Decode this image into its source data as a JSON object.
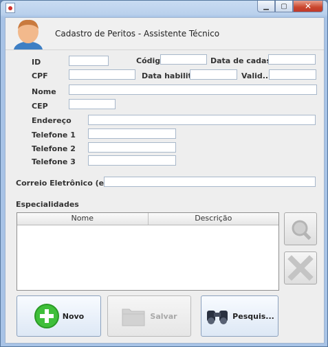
{
  "header": {
    "title": "Cadastro de Peritos - Assistente Técnico"
  },
  "form": {
    "id_label": "ID",
    "codigo_label": "Código",
    "data_cadastro_label": "Data de cadastro",
    "cpf_label": "CPF",
    "data_habilitacao_label": "Data habilitação",
    "validade_label": "Valid...",
    "nome_label": "Nome",
    "cep_label": "CEP",
    "endereco_label": "Endereço",
    "telefone1_label": "Telefone 1",
    "telefone2_label": "Telefone 2",
    "telefone3_label": "Telefone 3",
    "email_label": "Correio Eletrônico (email)",
    "especialidades_label": "Especialidades"
  },
  "table": {
    "columns": [
      "Nome",
      "Descrição"
    ],
    "rows": []
  },
  "buttons": {
    "novo": "Novo",
    "salvar": "Salvar",
    "pesquisar": "Pesquis..."
  },
  "colors": {
    "titlebar": "#b9d0ec",
    "close": "#c9462d",
    "new_green": "#3fbf3a"
  }
}
